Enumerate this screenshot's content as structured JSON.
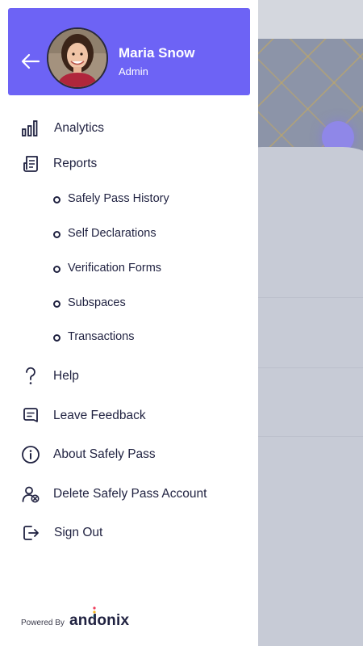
{
  "profile": {
    "name": "Maria Snow",
    "role": "Admin"
  },
  "menu": {
    "analytics": "Analytics",
    "reports": "Reports",
    "reports_sub": [
      "Safely Pass History",
      "Self Declarations",
      "Verification Forms",
      "Subspaces",
      "Transactions"
    ],
    "help": "Help",
    "leave_feedback": "Leave Feedback",
    "about": "About Safely Pass",
    "delete_account": "Delete Safely Pass Account",
    "sign_out": "Sign Out"
  },
  "footer": {
    "powered_by": "Powered By",
    "brand": "andonix"
  },
  "colors": {
    "accent": "#6d63f5",
    "text": "#1f2140",
    "brand_dots": [
      "#ef3b5b",
      "#f6b51e",
      "#26c0b6"
    ]
  }
}
